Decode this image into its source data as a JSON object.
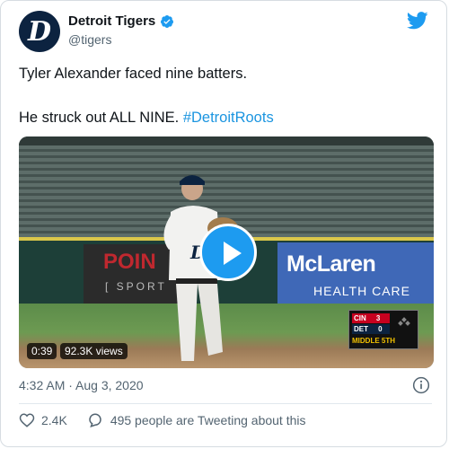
{
  "tweet": {
    "author_name": "Detroit Tigers",
    "handle": "@tigers",
    "avatar_letter": "D",
    "line1": "Tyler Alexander faced nine batters.",
    "line2_text": "He struck out ALL NINE. ",
    "hashtag": "#DetroitRoots",
    "timestamp": "4:32 AM · Aug 3, 2020",
    "likes": "2.4K",
    "tweeting": "495 people are Tweeting about this"
  },
  "video": {
    "duration": "0:39",
    "views": "92.3K views",
    "jersey_letter": "D",
    "ads": {
      "left_top": "POIN",
      "left_bottom": "[ SPORT",
      "right_top": "McLaren",
      "right_bottom": "HEALTH CARE"
    },
    "scorebug": {
      "team1": "CIN",
      "score1": "3",
      "team2": "DET",
      "score2": "0",
      "inning": "MIDDLE 5TH"
    }
  },
  "colors": {
    "accent": "#1d9bf0",
    "tigers_navy": "#0c2340",
    "text_secondary": "#536471"
  },
  "icons": [
    "verified-badge-icon",
    "twitter-bird-icon",
    "play-icon",
    "info-icon",
    "heart-icon",
    "reply-bubble-icon"
  ]
}
